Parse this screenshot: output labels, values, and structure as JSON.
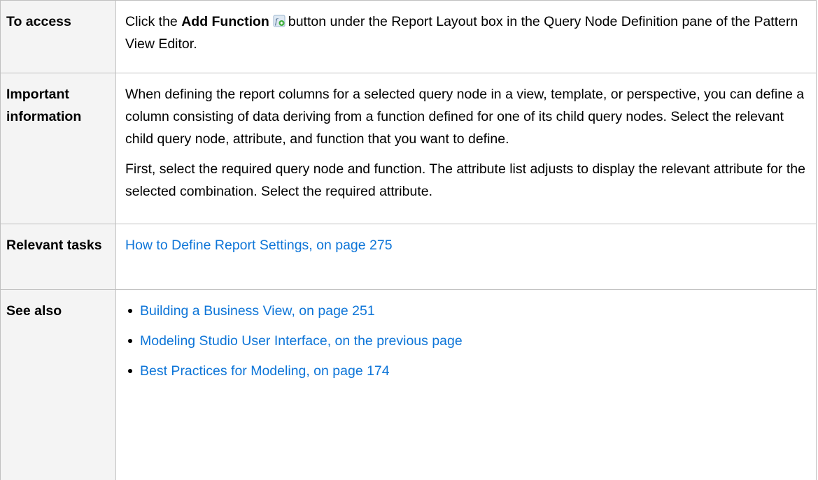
{
  "rows": {
    "access": {
      "label": "To access",
      "text_before": "Click the",
      "button_name": "Add Function",
      "icon": "add-function-icon",
      "text_after": "button under the Report Layout box in the Query Node Definition pane of the Pattern View Editor."
    },
    "important": {
      "label": "Important information",
      "paragraphs": [
        "When defining the report columns for a selected query node in a view, template, or perspective, you can define a column consisting of data deriving from a function defined for one of its child query nodes. Select the relevant child query node, attribute, and function that you want to define.",
        "First, select the required query node and function. The attribute list adjusts to display the relevant attribute for the selected combination. Select the required attribute."
      ]
    },
    "tasks": {
      "label": "Relevant tasks",
      "link": "How to Define Report Settings, on page 275"
    },
    "see_also": {
      "label": "See also",
      "links": [
        "Building a Business View, on page 251",
        "Modeling Studio User Interface, on the previous page",
        "Best Practices for Modeling, on page 174"
      ]
    }
  },
  "colors": {
    "link": "#0d75d8",
    "label_background": "#f4f4f4",
    "border": "#c0c0c0"
  }
}
